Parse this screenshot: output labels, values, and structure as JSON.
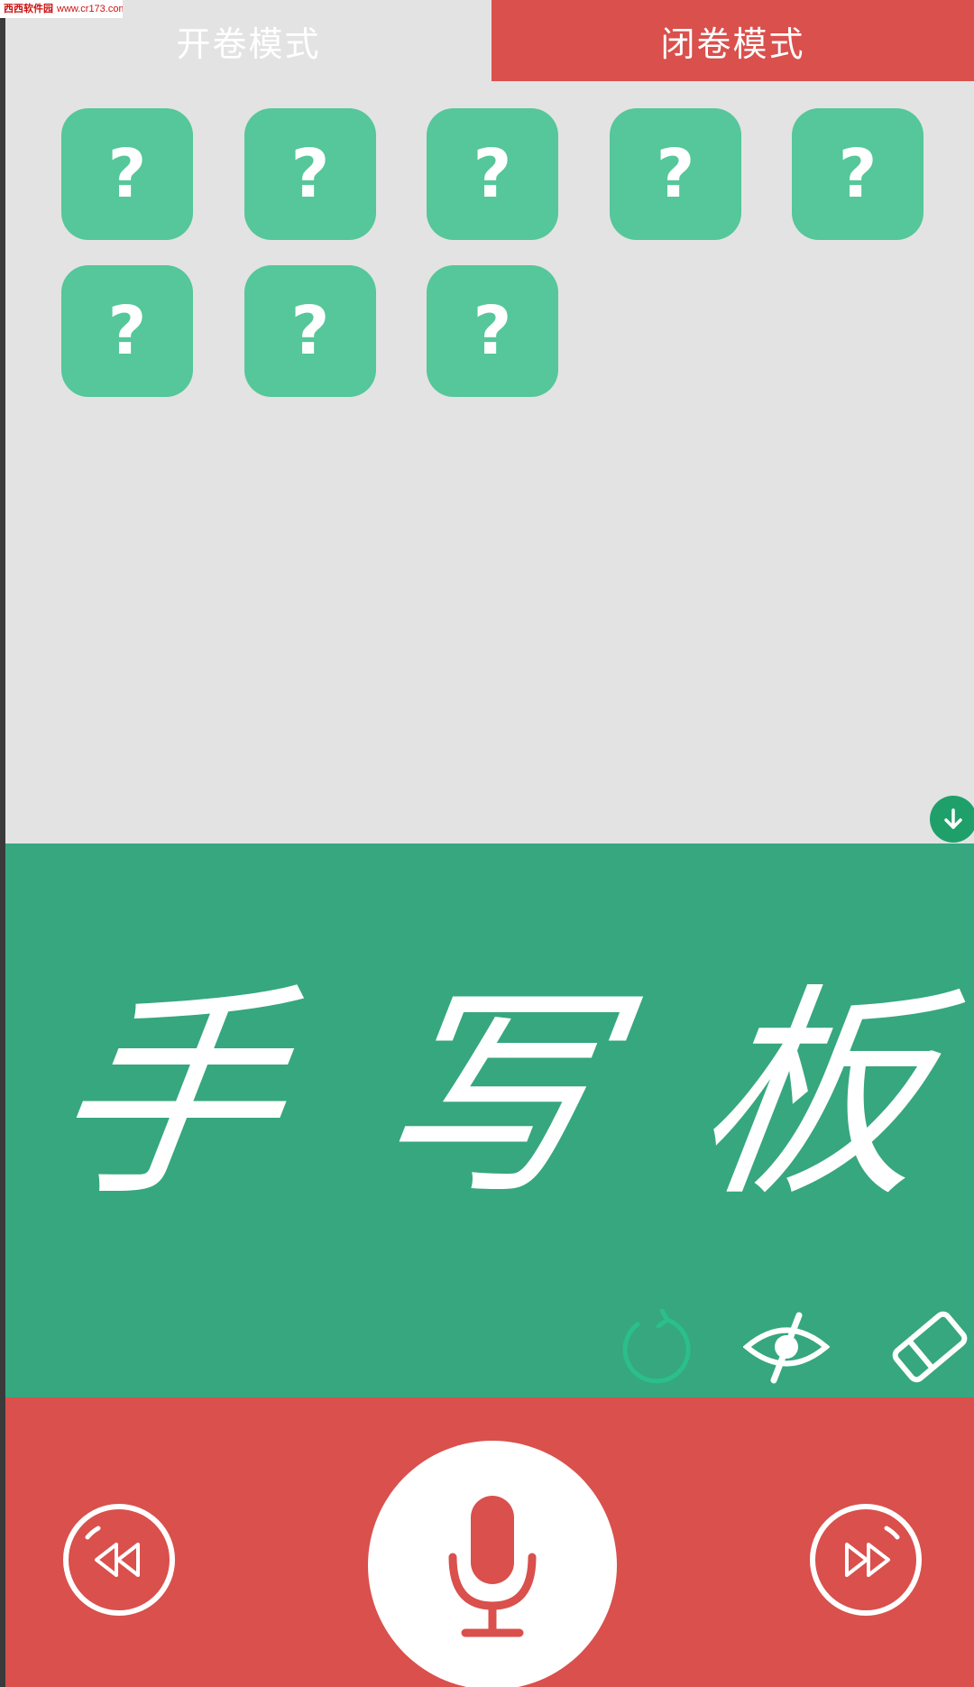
{
  "watermark": {
    "site_name": "西西软件园",
    "url": "www.cr173.com"
  },
  "tabs": {
    "open_book": "开卷模式",
    "closed_book": "闭卷模式"
  },
  "cards": [
    "?",
    "?",
    "?",
    "?",
    "?",
    "?",
    "?",
    "?"
  ],
  "board": {
    "chars": [
      "手",
      "写",
      "板"
    ]
  },
  "tools": [
    "undo-icon",
    "eye-off-icon",
    "eraser-icon"
  ],
  "controls": {
    "prev": "rewind-icon",
    "mic": "microphone-icon",
    "next": "fast-forward-icon"
  },
  "colors": {
    "tab_active": "#d9504c",
    "card": "#55c79a",
    "board": "#36a77f",
    "controls": "#d9504c",
    "download": "#1fa06a",
    "undo": "#2bbf8c"
  }
}
